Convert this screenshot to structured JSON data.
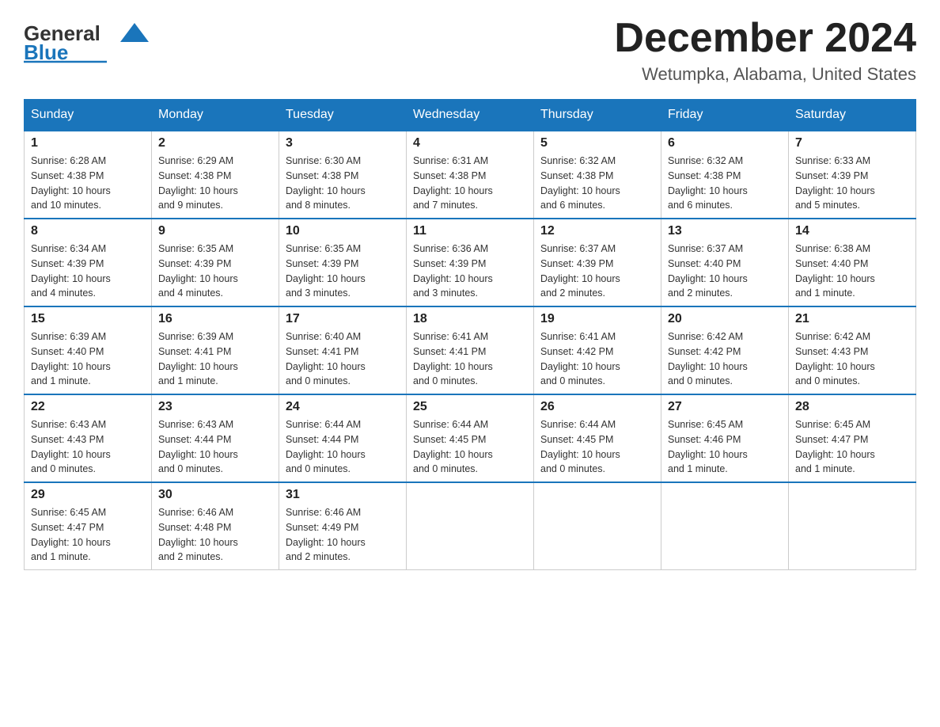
{
  "header": {
    "logo_general": "General",
    "logo_blue": "Blue",
    "month_title": "December 2024",
    "location": "Wetumpka, Alabama, United States"
  },
  "weekdays": [
    "Sunday",
    "Monday",
    "Tuesday",
    "Wednesday",
    "Thursday",
    "Friday",
    "Saturday"
  ],
  "weeks": [
    [
      {
        "day": "1",
        "sunrise": "6:28 AM",
        "sunset": "4:38 PM",
        "daylight": "10 hours and 10 minutes."
      },
      {
        "day": "2",
        "sunrise": "6:29 AM",
        "sunset": "4:38 PM",
        "daylight": "10 hours and 9 minutes."
      },
      {
        "day": "3",
        "sunrise": "6:30 AM",
        "sunset": "4:38 PM",
        "daylight": "10 hours and 8 minutes."
      },
      {
        "day": "4",
        "sunrise": "6:31 AM",
        "sunset": "4:38 PM",
        "daylight": "10 hours and 7 minutes."
      },
      {
        "day": "5",
        "sunrise": "6:32 AM",
        "sunset": "4:38 PM",
        "daylight": "10 hours and 6 minutes."
      },
      {
        "day": "6",
        "sunrise": "6:32 AM",
        "sunset": "4:38 PM",
        "daylight": "10 hours and 6 minutes."
      },
      {
        "day": "7",
        "sunrise": "6:33 AM",
        "sunset": "4:39 PM",
        "daylight": "10 hours and 5 minutes."
      }
    ],
    [
      {
        "day": "8",
        "sunrise": "6:34 AM",
        "sunset": "4:39 PM",
        "daylight": "10 hours and 4 minutes."
      },
      {
        "day": "9",
        "sunrise": "6:35 AM",
        "sunset": "4:39 PM",
        "daylight": "10 hours and 4 minutes."
      },
      {
        "day": "10",
        "sunrise": "6:35 AM",
        "sunset": "4:39 PM",
        "daylight": "10 hours and 3 minutes."
      },
      {
        "day": "11",
        "sunrise": "6:36 AM",
        "sunset": "4:39 PM",
        "daylight": "10 hours and 3 minutes."
      },
      {
        "day": "12",
        "sunrise": "6:37 AM",
        "sunset": "4:39 PM",
        "daylight": "10 hours and 2 minutes."
      },
      {
        "day": "13",
        "sunrise": "6:37 AM",
        "sunset": "4:40 PM",
        "daylight": "10 hours and 2 minutes."
      },
      {
        "day": "14",
        "sunrise": "6:38 AM",
        "sunset": "4:40 PM",
        "daylight": "10 hours and 1 minute."
      }
    ],
    [
      {
        "day": "15",
        "sunrise": "6:39 AM",
        "sunset": "4:40 PM",
        "daylight": "10 hours and 1 minute."
      },
      {
        "day": "16",
        "sunrise": "6:39 AM",
        "sunset": "4:41 PM",
        "daylight": "10 hours and 1 minute."
      },
      {
        "day": "17",
        "sunrise": "6:40 AM",
        "sunset": "4:41 PM",
        "daylight": "10 hours and 0 minutes."
      },
      {
        "day": "18",
        "sunrise": "6:41 AM",
        "sunset": "4:41 PM",
        "daylight": "10 hours and 0 minutes."
      },
      {
        "day": "19",
        "sunrise": "6:41 AM",
        "sunset": "4:42 PM",
        "daylight": "10 hours and 0 minutes."
      },
      {
        "day": "20",
        "sunrise": "6:42 AM",
        "sunset": "4:42 PM",
        "daylight": "10 hours and 0 minutes."
      },
      {
        "day": "21",
        "sunrise": "6:42 AM",
        "sunset": "4:43 PM",
        "daylight": "10 hours and 0 minutes."
      }
    ],
    [
      {
        "day": "22",
        "sunrise": "6:43 AM",
        "sunset": "4:43 PM",
        "daylight": "10 hours and 0 minutes."
      },
      {
        "day": "23",
        "sunrise": "6:43 AM",
        "sunset": "4:44 PM",
        "daylight": "10 hours and 0 minutes."
      },
      {
        "day": "24",
        "sunrise": "6:44 AM",
        "sunset": "4:44 PM",
        "daylight": "10 hours and 0 minutes."
      },
      {
        "day": "25",
        "sunrise": "6:44 AM",
        "sunset": "4:45 PM",
        "daylight": "10 hours and 0 minutes."
      },
      {
        "day": "26",
        "sunrise": "6:44 AM",
        "sunset": "4:45 PM",
        "daylight": "10 hours and 0 minutes."
      },
      {
        "day": "27",
        "sunrise": "6:45 AM",
        "sunset": "4:46 PM",
        "daylight": "10 hours and 1 minute."
      },
      {
        "day": "28",
        "sunrise": "6:45 AM",
        "sunset": "4:47 PM",
        "daylight": "10 hours and 1 minute."
      }
    ],
    [
      {
        "day": "29",
        "sunrise": "6:45 AM",
        "sunset": "4:47 PM",
        "daylight": "10 hours and 1 minute."
      },
      {
        "day": "30",
        "sunrise": "6:46 AM",
        "sunset": "4:48 PM",
        "daylight": "10 hours and 2 minutes."
      },
      {
        "day": "31",
        "sunrise": "6:46 AM",
        "sunset": "4:49 PM",
        "daylight": "10 hours and 2 minutes."
      },
      null,
      null,
      null,
      null
    ]
  ],
  "labels": {
    "sunrise": "Sunrise:",
    "sunset": "Sunset:",
    "daylight": "Daylight:"
  }
}
